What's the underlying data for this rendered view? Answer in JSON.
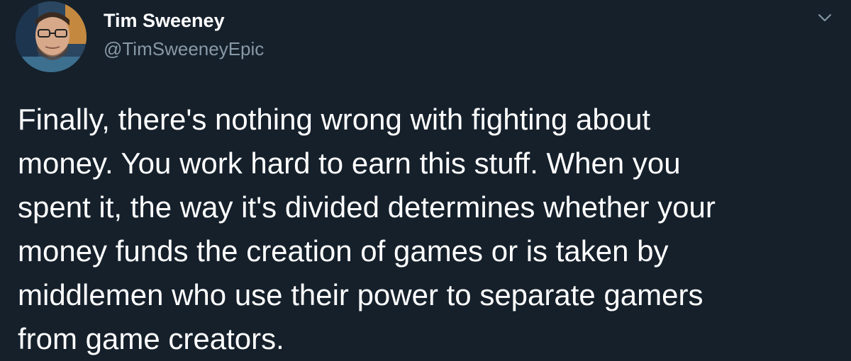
{
  "tweet": {
    "author": {
      "name": "Tim Sweeney",
      "handle": "@TimSweeneyEpic"
    },
    "menu_icon": "chevron-down-icon",
    "text_lines": [
      "Finally, there's nothing wrong with fighting about",
      "money. You work hard to earn this stuff. When you",
      "spent it, the way it's divided determines whether your",
      "money funds the creation of games or is taken by",
      "middlemen who use their power to separate gamers",
      "from game creators."
    ]
  },
  "colors": {
    "background": "#15202b",
    "text": "#ffffff",
    "secondary_text": "#8899a6"
  }
}
